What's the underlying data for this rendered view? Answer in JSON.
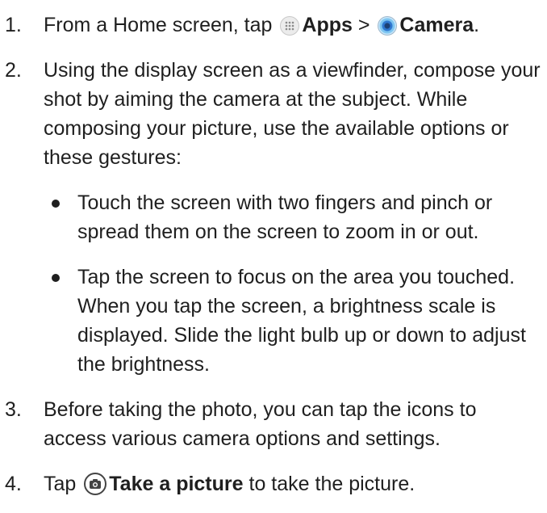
{
  "steps": [
    {
      "number": "1.",
      "pre": "From a Home screen, tap",
      "apps_label": "Apps",
      "separator": ">",
      "camera_label": "Camera",
      "post": "."
    },
    {
      "number": "2.",
      "text": "Using the display screen as a viewfinder, compose your shot by aiming the camera at the subject. While composing your picture, use the available options or these gestures:",
      "bullets": [
        "Touch the screen with two fingers and pinch or spread them on the screen to zoom in or out.",
        "Tap the screen to focus on the area you touched. When you tap the screen, a brightness scale is displayed. Slide the light bulb up or down to adjust the brightness."
      ]
    },
    {
      "number": "3.",
      "text": "Before taking the photo, you can tap the icons to access various camera options and settings."
    },
    {
      "number": "4.",
      "pre": "Tap",
      "bold": "Take a picture",
      "post": "to take the picture."
    }
  ],
  "icons": {
    "apps": "apps-grid-icon",
    "camera": "camera-app-icon",
    "shutter": "take-picture-icon"
  }
}
